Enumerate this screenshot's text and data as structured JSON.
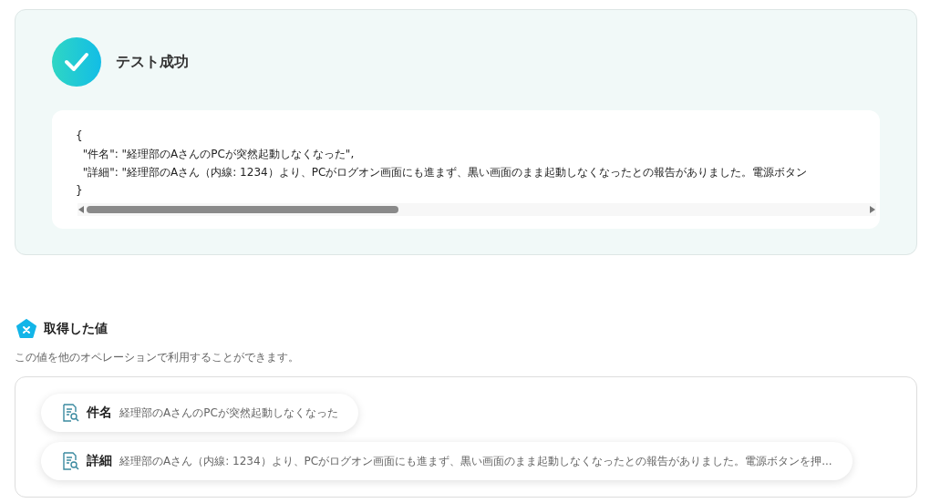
{
  "result": {
    "title": "テスト成功",
    "code_lines": [
      "{",
      "  \"件名\": \"経理部のAさんのPCが突然起動しなくなった\",",
      "  \"詳細\": \"経理部のAさん（内線: 1234）より、PCがログオン画面にも進まず、黒い画面のまま起動しなくなったとの報告がありました。電源ボタン",
      "}"
    ]
  },
  "values": {
    "title": "取得した値",
    "description": "この値を他のオペレーションで利用することができます。",
    "items": [
      {
        "label": "件名",
        "value": "経理部のAさんのPCが突然起動しなくなった"
      },
      {
        "label": "詳細",
        "value": "経理部のAさん（内線: 1234）より、PCがログオン画面にも進まず、黒い画面のまま起動しなくなったとの報告がありました。電源ボタンを押..."
      }
    ]
  }
}
